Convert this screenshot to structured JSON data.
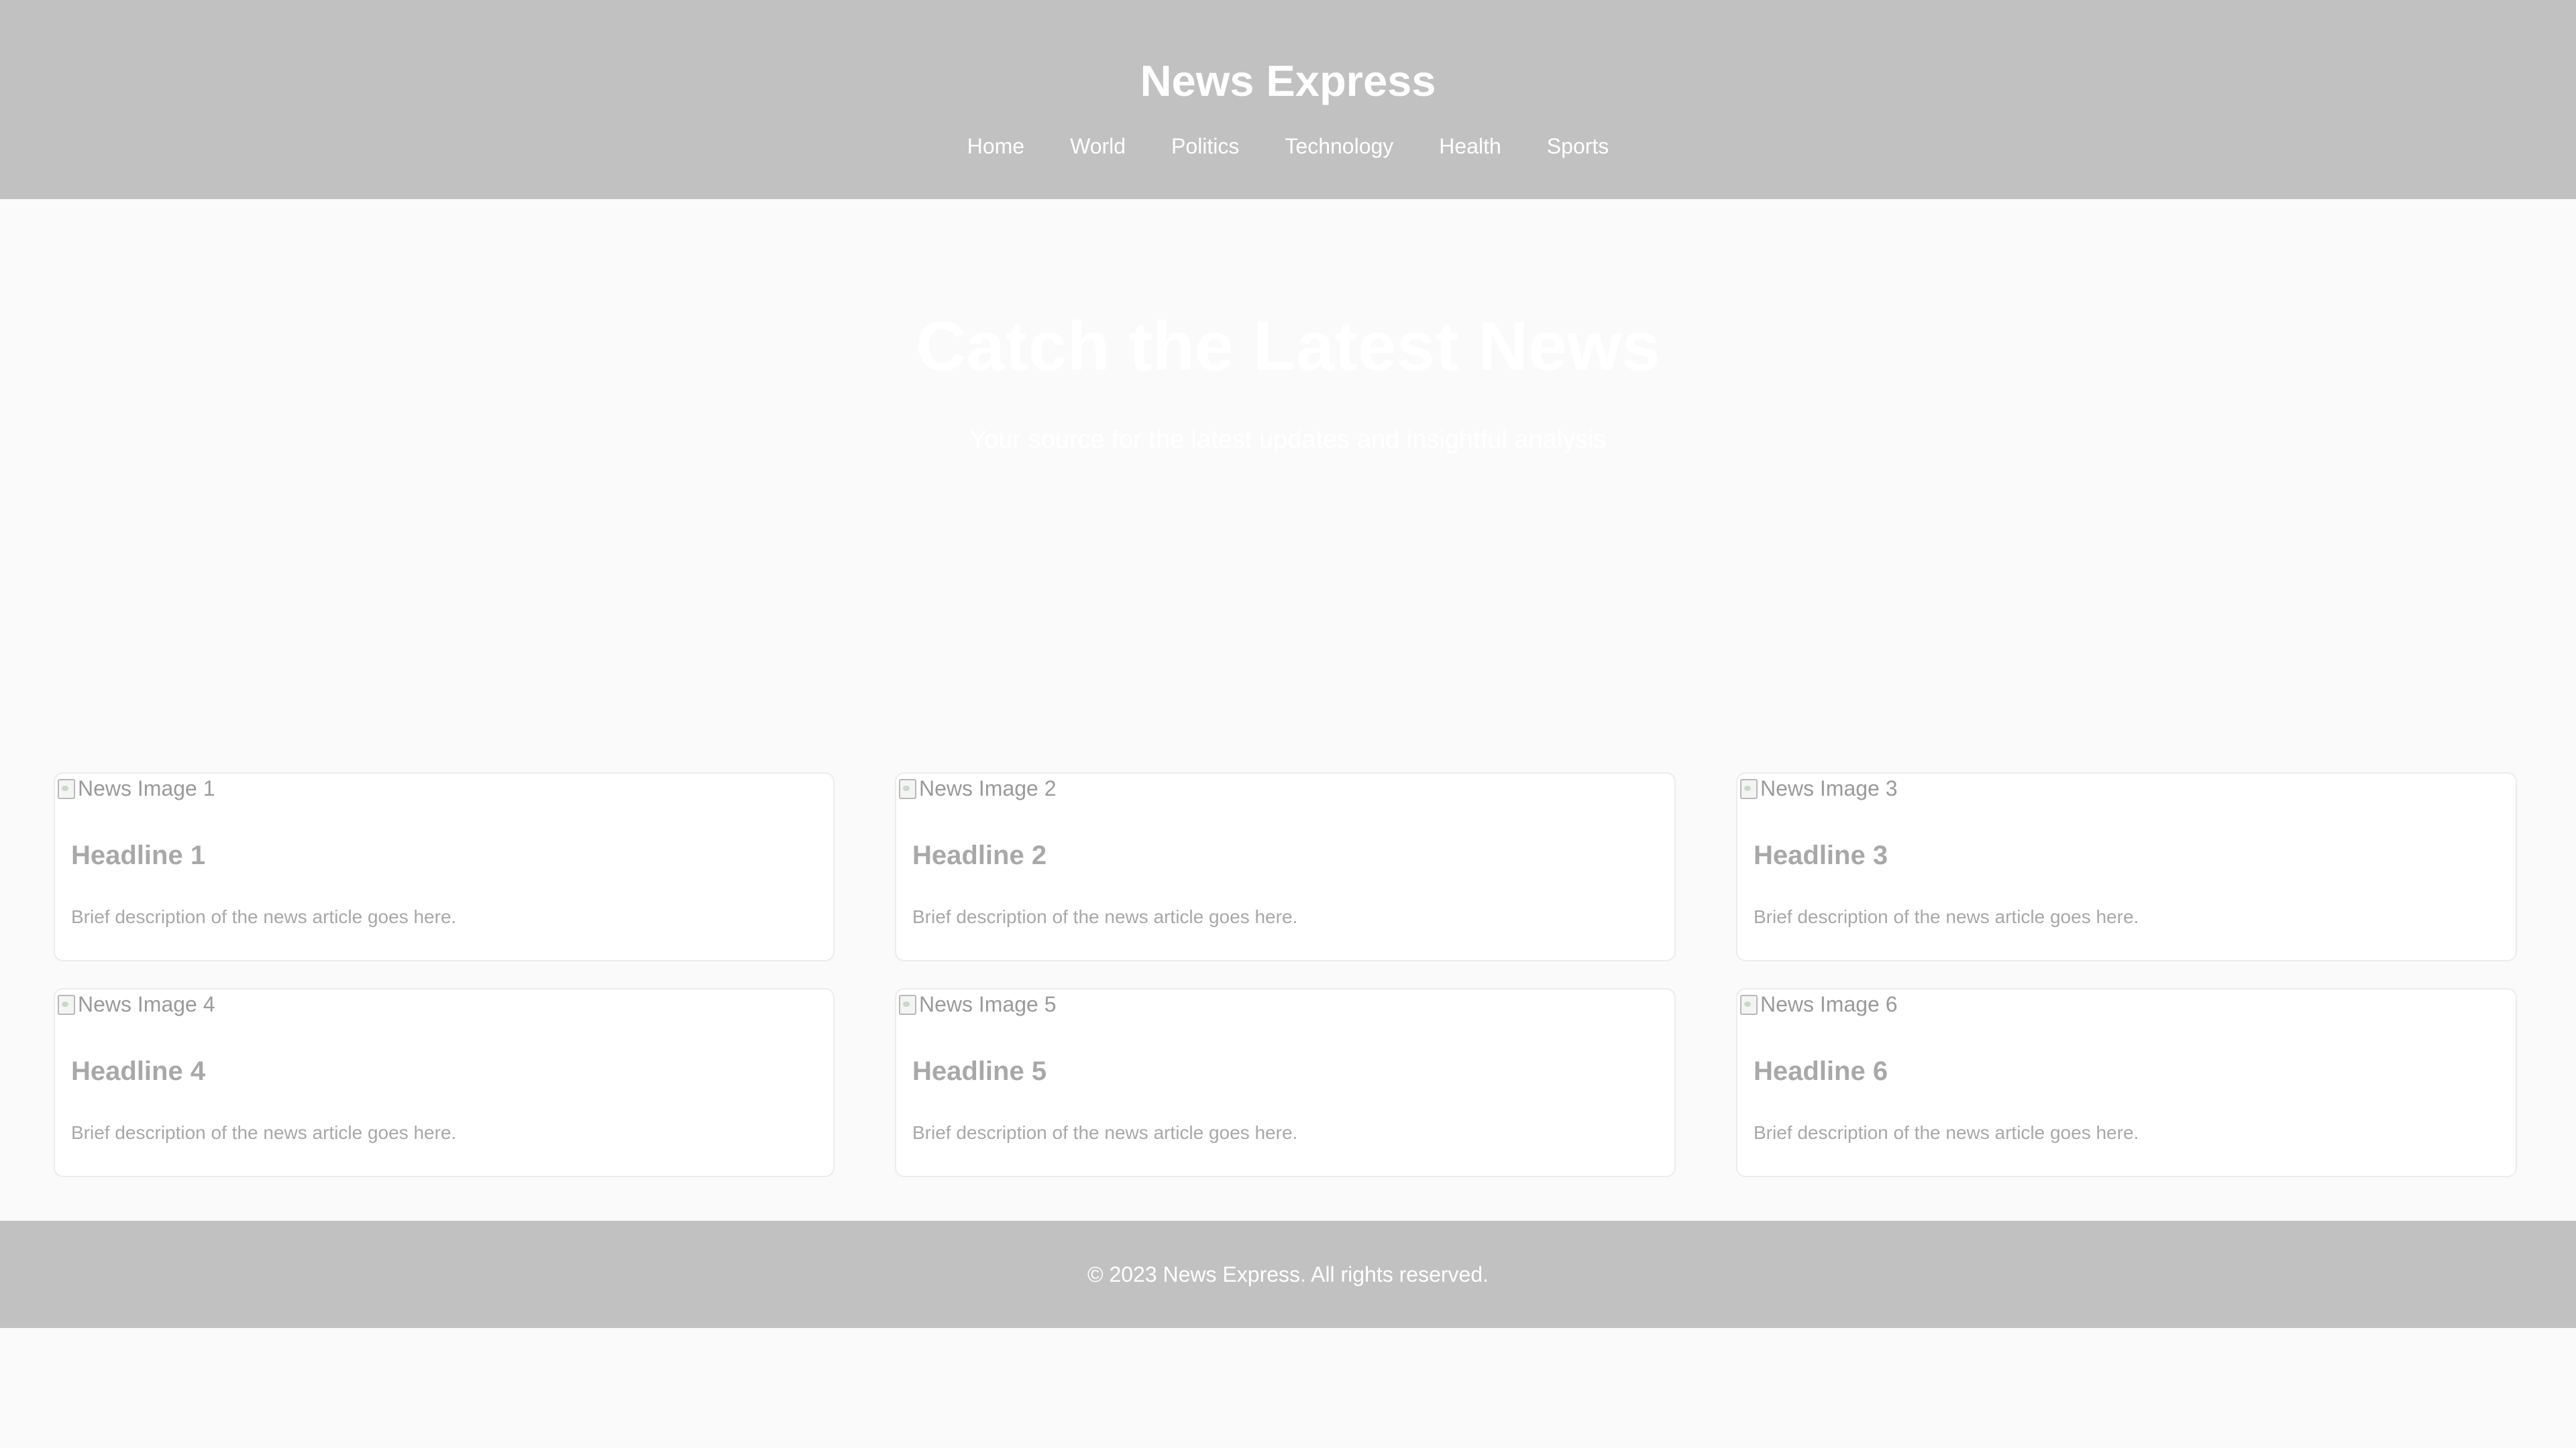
{
  "header": {
    "title": "News Express",
    "nav": [
      {
        "label": "Home"
      },
      {
        "label": "World"
      },
      {
        "label": "Politics"
      },
      {
        "label": "Technology"
      },
      {
        "label": "Health"
      },
      {
        "label": "Sports"
      }
    ]
  },
  "hero": {
    "title": "Catch the Latest News",
    "subtitle": "Your source for the latest updates and insightful analysis"
  },
  "articles": [
    {
      "image_alt": "News Image 1",
      "headline": "Headline 1",
      "description": "Brief description of the news article goes here."
    },
    {
      "image_alt": "News Image 2",
      "headline": "Headline 2",
      "description": "Brief description of the news article goes here."
    },
    {
      "image_alt": "News Image 3",
      "headline": "Headline 3",
      "description": "Brief description of the news article goes here."
    },
    {
      "image_alt": "News Image 4",
      "headline": "Headline 4",
      "description": "Brief description of the news article goes here."
    },
    {
      "image_alt": "News Image 5",
      "headline": "Headline 5",
      "description": "Brief description of the news article goes here."
    },
    {
      "image_alt": "News Image 6",
      "headline": "Headline 6",
      "description": "Brief description of the news article goes here."
    }
  ],
  "footer": {
    "copyright": "© 2023 News Express. All rights reserved."
  },
  "colors": {
    "header_bg": "#c1c1c1",
    "page_bg": "#fafafa",
    "card_bg": "#ffffff",
    "text_muted": "#a8a8a8"
  }
}
